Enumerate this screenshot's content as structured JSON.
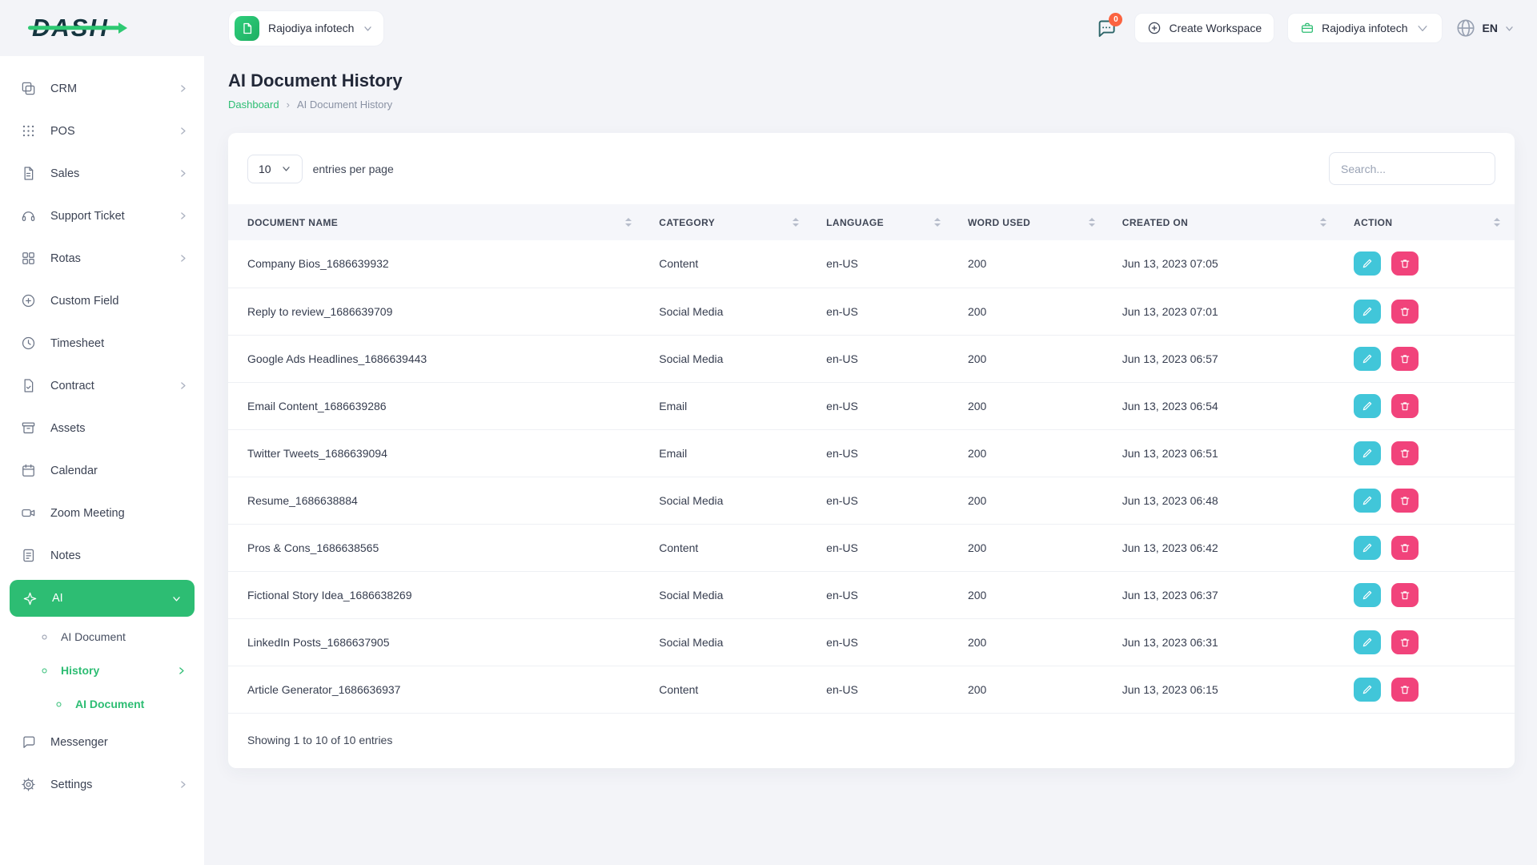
{
  "brand": {
    "name": "DASH"
  },
  "header": {
    "workspace_selector": {
      "label": "Rajodiya infotech"
    },
    "notifications_badge": "0",
    "create_workspace_label": "Create Workspace",
    "company_menu_label": "Rajodiya infotech",
    "language_label": "EN"
  },
  "sidebar": {
    "items": [
      {
        "label": "CRM",
        "icon": "crm-icon"
      },
      {
        "label": "POS",
        "icon": "pos-icon"
      },
      {
        "label": "Sales",
        "icon": "sales-icon"
      },
      {
        "label": "Support Ticket",
        "icon": "support-ticket-icon"
      },
      {
        "label": "Rotas",
        "icon": "rotas-icon"
      },
      {
        "label": "Custom Field",
        "icon": "custom-field-icon"
      },
      {
        "label": "Timesheet",
        "icon": "timesheet-icon"
      },
      {
        "label": "Contract",
        "icon": "contract-icon"
      },
      {
        "label": "Assets",
        "icon": "assets-icon"
      },
      {
        "label": "Calendar",
        "icon": "calendar-icon"
      },
      {
        "label": "Zoom Meeting",
        "icon": "zoom-meeting-icon"
      },
      {
        "label": "Notes",
        "icon": "notes-icon"
      },
      {
        "label": "AI",
        "icon": "ai-icon",
        "active": true
      },
      {
        "label": "AI Document",
        "icon": "circle-icon",
        "level": "sub"
      },
      {
        "label": "History",
        "icon": "circle-icon",
        "level": "sub",
        "active": true
      },
      {
        "label": "AI Document",
        "icon": "circle-icon",
        "level": "sub-sub",
        "active": true
      },
      {
        "label": "Messenger",
        "icon": "messenger-icon"
      },
      {
        "label": "Settings",
        "icon": "settings-icon"
      }
    ]
  },
  "page": {
    "title": "AI Document History",
    "breadcrumb": {
      "home": "Dashboard",
      "separator": "›",
      "current": "AI Document History"
    }
  },
  "controls": {
    "page_size": "10",
    "entries_label": "entries per page",
    "search_placeholder": "Search..."
  },
  "table": {
    "columns": [
      "DOCUMENT NAME",
      "CATEGORY",
      "LANGUAGE",
      "WORD USED",
      "CREATED ON",
      "ACTION"
    ],
    "rows": [
      {
        "name": "Company Bios_1686639932",
        "category": "Content",
        "language": "en-US",
        "words": "200",
        "created": "Jun 13, 2023 07:05"
      },
      {
        "name": "Reply to review_1686639709",
        "category": "Social Media",
        "language": "en-US",
        "words": "200",
        "created": "Jun 13, 2023 07:01"
      },
      {
        "name": "Google Ads Headlines_1686639443",
        "category": "Social Media",
        "language": "en-US",
        "words": "200",
        "created": "Jun 13, 2023 06:57"
      },
      {
        "name": "Email Content_1686639286",
        "category": "Email",
        "language": "en-US",
        "words": "200",
        "created": "Jun 13, 2023 06:54"
      },
      {
        "name": "Twitter Tweets_1686639094",
        "category": "Email",
        "language": "en-US",
        "words": "200",
        "created": "Jun 13, 2023 06:51"
      },
      {
        "name": "Resume_1686638884",
        "category": "Social Media",
        "language": "en-US",
        "words": "200",
        "created": "Jun 13, 2023 06:48"
      },
      {
        "name": "Pros & Cons_1686638565",
        "category": "Content",
        "language": "en-US",
        "words": "200",
        "created": "Jun 13, 2023 06:42"
      },
      {
        "name": "Fictional Story Idea_1686638269",
        "category": "Social Media",
        "language": "en-US",
        "words": "200",
        "created": "Jun 13, 2023 06:37"
      },
      {
        "name": "LinkedIn Posts_1686637905",
        "category": "Social Media",
        "language": "en-US",
        "words": "200",
        "created": "Jun 13, 2023 06:31"
      },
      {
        "name": "Article Generator_1686636937",
        "category": "Content",
        "language": "en-US",
        "words": "200",
        "created": "Jun 13, 2023 06:15"
      }
    ],
    "footer": "Showing 1 to 10 of 10 entries"
  },
  "colors": {
    "accent_green": "#2dbd73",
    "edit_teal": "#41c6d9",
    "delete_pink": "#f1437b",
    "badge_orange": "#fb6340"
  }
}
